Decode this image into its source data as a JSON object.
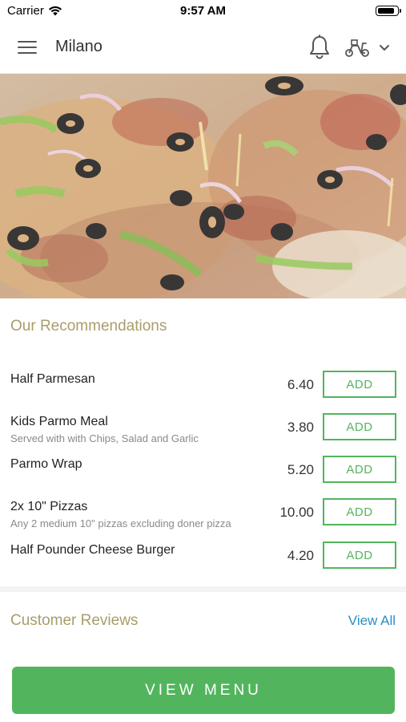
{
  "status_bar": {
    "carrier": "Carrier",
    "time": "9:57 AM",
    "battery_level": 0.9
  },
  "header": {
    "title": "Milano",
    "icons": {
      "menu": "hamburger-menu-icon",
      "notifications": "bell-icon",
      "delivery": "scooter-icon",
      "dropdown": "chevron-down-icon"
    }
  },
  "hero": {
    "image": "pizza-photo"
  },
  "recommendations": {
    "title": "Our Recommendations",
    "items": [
      {
        "name": "Half Parmesan",
        "description": "",
        "price": "6.40",
        "action": "ADD"
      },
      {
        "name": "Kids Parmo Meal",
        "description": "Served with with Chips, Salad and Garlic",
        "price": "3.80",
        "action": "ADD"
      },
      {
        "name": "Parmo Wrap",
        "description": "",
        "price": "5.20",
        "action": "ADD"
      },
      {
        "name": "2x 10\" Pizzas",
        "description": "Any 2 medium 10\" pizzas excluding doner pizza",
        "price": "10.00",
        "action": "ADD"
      },
      {
        "name": "Half Pounder Cheese Burger",
        "description": "",
        "price": "4.20",
        "action": "ADD"
      }
    ]
  },
  "reviews": {
    "title": "Customer Reviews",
    "view_all_label": "View All"
  },
  "footer": {
    "view_menu_label": "VIEW MENU"
  },
  "colors": {
    "accent_green": "#52b55d",
    "section_title": "#a89d6b",
    "link_blue": "#2a8fc4"
  }
}
